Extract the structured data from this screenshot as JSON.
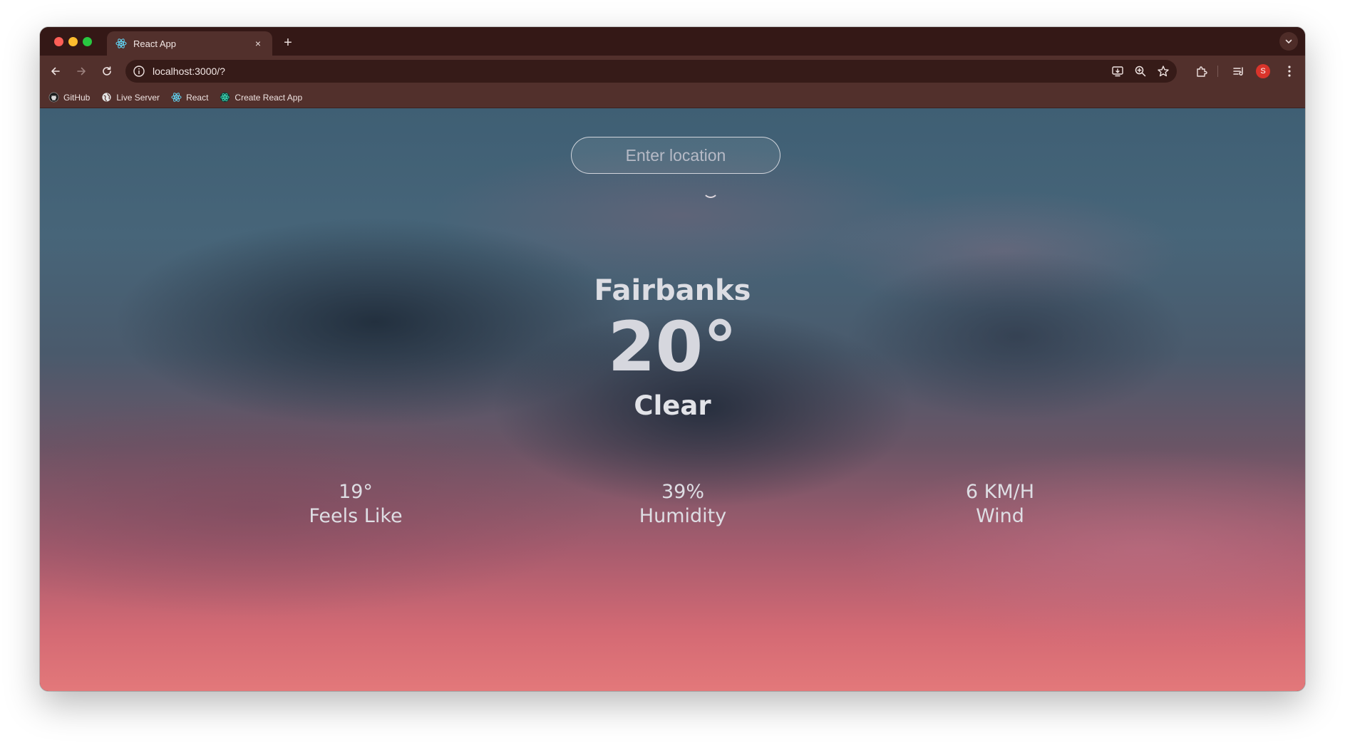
{
  "browser": {
    "tab": {
      "title": "React App",
      "close": "×"
    },
    "new_tab": "+",
    "address": "localhost:3000/?",
    "bookmarks": [
      {
        "label": "GitHub"
      },
      {
        "label": "Live Server"
      },
      {
        "label": "React"
      },
      {
        "label": "Create React App"
      }
    ],
    "profile_initial": "S"
  },
  "app": {
    "search_placeholder": "Enter location",
    "city": "Fairbanks",
    "temperature": "20°",
    "condition": "Clear",
    "stats": {
      "feels_like": {
        "value": "19°",
        "label": "Feels Like"
      },
      "humidity": {
        "value": "39%",
        "label": "Humidity"
      },
      "wind": {
        "value": "6 KM/H",
        "label": "Wind"
      }
    }
  },
  "colors": {
    "titlebar": "#341816",
    "toolbar": "#52302c",
    "text_light": "#dcdde3"
  }
}
